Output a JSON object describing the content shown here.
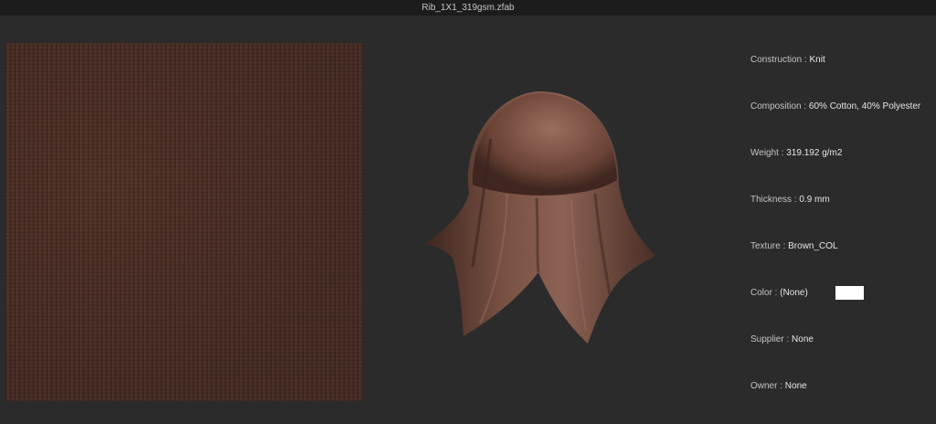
{
  "window": {
    "title": "Rib_1X1_319gsm.zfab"
  },
  "properties": [
    {
      "label": "Construction :",
      "value": "Knit"
    },
    {
      "label": "Composition :",
      "value": "60% Cotton, 40% Polyester"
    },
    {
      "label": "Weight :",
      "value": "319.192 g/m2"
    },
    {
      "label": "Thickness :",
      "value": "0.9 mm"
    },
    {
      "label": "Texture :",
      "value": "Brown_COL"
    },
    {
      "label": "Color :",
      "value": "(None)"
    },
    {
      "label": "Supplier :",
      "value": "None"
    },
    {
      "label": "Owner :",
      "value": "None"
    }
  ],
  "colors": {
    "fabric": "#5e3d33",
    "color_chip": "#ffffff"
  }
}
